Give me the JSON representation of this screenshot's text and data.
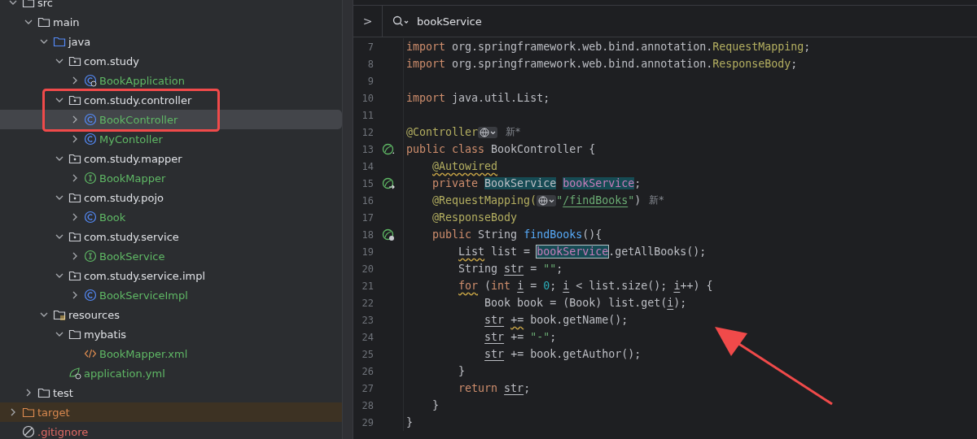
{
  "project_tree": [
    {
      "name": "src",
      "kind": "folder",
      "expanded": true,
      "selected": false,
      "children": [
        {
          "name": "main",
          "kind": "folder",
          "expanded": true,
          "selected": false,
          "children": [
            {
              "name": "java",
              "kind": "source-folder",
              "expanded": true,
              "selected": false,
              "children": [
                {
                  "name": "com.study",
                  "kind": "package",
                  "expanded": true,
                  "selected": false,
                  "children": [
                    {
                      "name": "BookApplication",
                      "kind": "spring-class",
                      "changed": true,
                      "expanded": false,
                      "selected": false
                    }
                  ]
                },
                {
                  "name": "com.study.controller",
                  "kind": "package",
                  "expanded": true,
                  "selected": false,
                  "children": [
                    {
                      "name": "BookController",
                      "kind": "class",
                      "changed": true,
                      "expanded": false,
                      "selected": true
                    },
                    {
                      "name": "MyContoller",
                      "kind": "class",
                      "changed": true,
                      "expanded": false,
                      "selected": false
                    }
                  ]
                },
                {
                  "name": "com.study.mapper",
                  "kind": "package",
                  "expanded": true,
                  "selected": false,
                  "children": [
                    {
                      "name": "BookMapper",
                      "kind": "interface",
                      "changed": true,
                      "expanded": false,
                      "selected": false
                    }
                  ]
                },
                {
                  "name": "com.study.pojo",
                  "kind": "package",
                  "expanded": true,
                  "selected": false,
                  "children": [
                    {
                      "name": "Book",
                      "kind": "class",
                      "changed": true,
                      "expanded": false,
                      "selected": false
                    }
                  ]
                },
                {
                  "name": "com.study.service",
                  "kind": "package",
                  "expanded": true,
                  "selected": false,
                  "children": [
                    {
                      "name": "BookService",
                      "kind": "interface",
                      "changed": true,
                      "expanded": false,
                      "selected": false
                    }
                  ]
                },
                {
                  "name": "com.study.service.impl",
                  "kind": "package",
                  "expanded": true,
                  "selected": false,
                  "children": [
                    {
                      "name": "BookServiceImpl",
                      "kind": "class",
                      "changed": true,
                      "expanded": false,
                      "selected": false
                    }
                  ]
                }
              ]
            },
            {
              "name": "resources",
              "kind": "resources-folder",
              "expanded": true,
              "selected": false,
              "children": [
                {
                  "name": "mybatis",
                  "kind": "folder",
                  "expanded": true,
                  "selected": false,
                  "children": [
                    {
                      "name": "BookMapper.xml",
                      "kind": "xml",
                      "changed": true,
                      "selected": false
                    }
                  ]
                },
                {
                  "name": "application.yml",
                  "kind": "yml",
                  "changed": true,
                  "selected": false
                }
              ]
            }
          ]
        },
        {
          "name": "test",
          "kind": "folder",
          "expanded": false,
          "selected": false
        }
      ]
    },
    {
      "name": "target",
      "kind": "excluded-folder",
      "expanded": false,
      "selected": false
    },
    {
      "name": ".gitignore",
      "kind": "ignore",
      "ignored": true,
      "selected": false
    }
  ],
  "editor": {
    "breadcrumb_toggle": ">",
    "search": "bookService",
    "lines": [
      {
        "number": "7",
        "tokens": [
          {
            "kind": "kw",
            "t": "import"
          },
          {
            "kind": "plain",
            "t": " org.springframework.web.bind.annotation."
          },
          {
            "kind": "type",
            "t": "RequestMapping"
          },
          {
            "kind": "plain",
            "t": ";"
          }
        ]
      },
      {
        "number": "8",
        "tokens": [
          {
            "kind": "kw",
            "t": "import"
          },
          {
            "kind": "plain",
            "t": " org.springframework.web.bind.annotation."
          },
          {
            "kind": "type",
            "t": "ResponseBody"
          },
          {
            "kind": "plain",
            "t": ";"
          }
        ]
      },
      {
        "number": "9"
      },
      {
        "number": "10",
        "tokens": [
          {
            "kind": "kw",
            "t": "import"
          },
          {
            "kind": "plain",
            "t": " java.util.List;"
          }
        ]
      },
      {
        "number": "11"
      },
      {
        "number": "12",
        "tokens": [
          {
            "kind": "ann",
            "t": "@Controller"
          },
          {
            "kind": "globe"
          },
          {
            "kind": "hint",
            "t": "新*"
          }
        ]
      },
      {
        "number": "13",
        "gutter": {
          "kind": "bean"
        },
        "tokens": [
          {
            "kind": "kw",
            "t": "public class"
          },
          {
            "kind": "plain",
            "t": " BookController {"
          }
        ]
      },
      {
        "number": "14",
        "tokens": [
          {
            "kind": "ann",
            "t": "    @Autowired",
            "wavy": true
          }
        ]
      },
      {
        "number": "15",
        "gutter": {
          "kind": "bean-arrow"
        },
        "tokens": [
          {
            "kind": "kw",
            "t": "    private"
          },
          {
            "kind": "plain",
            "t": " BookService",
            "highlighted": true
          },
          {
            "kind": "field",
            "t": " bookService",
            "highlighted": true
          },
          {
            "kind": "plain",
            "t": ";"
          }
        ]
      },
      {
        "number": "16",
        "tokens": [
          {
            "kind": "ann",
            "t": "    @RequestMapping("
          },
          {
            "kind": "globe"
          },
          {
            "kind": "str",
            "t": "\""
          },
          {
            "kind": "str",
            "t": "/findBooks",
            "underlined": true
          },
          {
            "kind": "str",
            "t": "\""
          },
          {
            "kind": "plain",
            "t": ")"
          },
          {
            "kind": "hint",
            "t": "新*"
          }
        ]
      },
      {
        "number": "17",
        "tokens": [
          {
            "kind": "ann",
            "t": "    @ResponseBody"
          }
        ]
      },
      {
        "number": "18",
        "gutter": {
          "kind": "bean-web"
        },
        "tokens": [
          {
            "kind": "kw",
            "t": "    public"
          },
          {
            "kind": "plain",
            "t": " String "
          },
          {
            "kind": "fn",
            "t": "findBooks"
          },
          {
            "kind": "plain",
            "t": "(){"
          }
        ]
      },
      {
        "number": "19",
        "tokens": [
          {
            "kind": "plain",
            "t": "        List",
            "wavy": true
          },
          {
            "kind": "plain",
            "t": " list = "
          },
          {
            "kind": "field",
            "t": "bookService",
            "highlighted": true,
            "boxed": true
          },
          {
            "kind": "plain",
            "t": ".getAllBooks();"
          }
        ]
      },
      {
        "number": "20",
        "tokens": [
          {
            "kind": "plain",
            "t": "        String "
          },
          {
            "kind": "plain",
            "t": "str",
            "underlined": true
          },
          {
            "kind": "plain",
            "t": " = "
          },
          {
            "kind": "str",
            "t": "\"\""
          },
          {
            "kind": "plain",
            "t": ";"
          }
        ]
      },
      {
        "number": "21",
        "tokens": [
          {
            "kind": "kw",
            "t": "        for",
            "wavy": true
          },
          {
            "kind": "plain",
            "t": " ("
          },
          {
            "kind": "kw",
            "t": "int"
          },
          {
            "kind": "plain",
            "t": " i",
            "underlined": true
          },
          {
            "kind": "plain",
            "t": " = "
          },
          {
            "kind": "num",
            "t": "0"
          },
          {
            "kind": "plain",
            "t": ";"
          },
          {
            "kind": "plain",
            "t": " i",
            "underlined": true
          },
          {
            "kind": "plain",
            "t": " < list.size();"
          },
          {
            "kind": "plain",
            "t": " i",
            "underlined": true
          },
          {
            "kind": "plain",
            "t": "++) {"
          }
        ]
      },
      {
        "number": "22",
        "tokens": [
          {
            "kind": "plain",
            "t": "            Book book = (Book) list.get("
          },
          {
            "kind": "plain",
            "t": "i",
            "underlined": true
          },
          {
            "kind": "plain",
            "t": ");"
          }
        ]
      },
      {
        "number": "23",
        "tokens": [
          {
            "kind": "plain",
            "t": "            str",
            "underlined": true
          },
          {
            "kind": "plain",
            "t": " +=",
            "wavy": true
          },
          {
            "kind": "plain",
            "t": " book.getName();"
          }
        ]
      },
      {
        "number": "24",
        "tokens": [
          {
            "kind": "plain",
            "t": "            str",
            "underlined": true
          },
          {
            "kind": "plain",
            "t": " += "
          },
          {
            "kind": "str",
            "t": "\"-\""
          },
          {
            "kind": "plain",
            "t": ";"
          }
        ]
      },
      {
        "number": "25",
        "tokens": [
          {
            "kind": "plain",
            "t": "            str",
            "underlined": true
          },
          {
            "kind": "plain",
            "t": " += book.getAuthor();"
          }
        ]
      },
      {
        "number": "26",
        "tokens": [
          {
            "kind": "plain",
            "t": "        }"
          }
        ]
      },
      {
        "number": "27",
        "tokens": [
          {
            "kind": "kw",
            "t": "        return"
          },
          {
            "kind": "plain",
            "t": " str",
            "underlined": true
          },
          {
            "kind": "plain",
            "t": ";"
          }
        ]
      },
      {
        "number": "28",
        "tokens": [
          {
            "kind": "plain",
            "t": "    }"
          }
        ]
      },
      {
        "number": "29",
        "tokens": [
          {
            "kind": "plain",
            "t": "}"
          }
        ]
      }
    ]
  },
  "annotations": {
    "highlight_box": true,
    "arrow": true
  }
}
